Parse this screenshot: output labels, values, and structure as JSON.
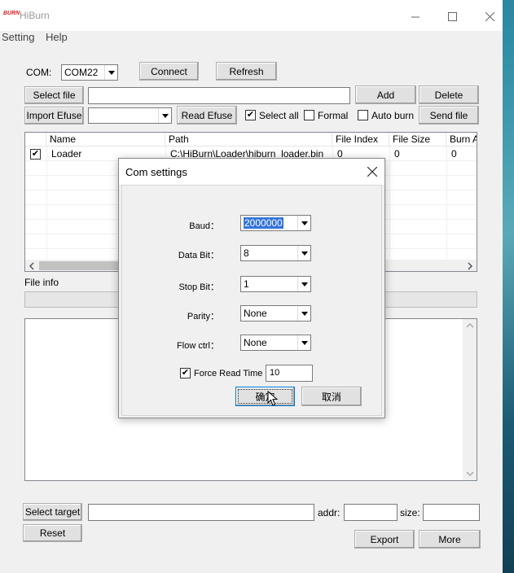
{
  "app": {
    "title": "HiBurn",
    "logo_text": "BURN",
    "window_controls": [
      "minimize-icon",
      "maximize-icon",
      "close-icon"
    ]
  },
  "menu": {
    "items": [
      "Setting",
      "Help"
    ]
  },
  "com_row": {
    "label": "COM:",
    "port_value": "COM22",
    "connect_label": "Connect",
    "refresh_label": "Refresh"
  },
  "file_row": {
    "select_file_label": "Select file",
    "file_path_value": "",
    "add_label": "Add",
    "delete_label": "Delete"
  },
  "efuse_row": {
    "import_efuse_label": "Import Efuse",
    "efuse_select_value": "",
    "read_efuse_label": "Read Efuse",
    "select_all_label": "Select all",
    "select_all_checked": true,
    "formal_label": "Formal",
    "formal_checked": false,
    "auto_burn_label": "Auto burn",
    "auto_burn_checked": false,
    "send_file_label": "Send file"
  },
  "table": {
    "columns": [
      "Name",
      "Path",
      "File Index",
      "File Size",
      "Burn A"
    ],
    "rows": [
      {
        "checked": true,
        "name": "Loader",
        "path": "C:\\HiBurn\\Loader\\hiburn_loader.bin",
        "file_index": "0",
        "file_size": "0",
        "burn_a": "0"
      }
    ]
  },
  "file_info": {
    "label": "File info"
  },
  "bottom": {
    "select_target_label": "Select target",
    "target_value": "",
    "addr_label": "addr:",
    "addr_value": "",
    "size_label": "size:",
    "size_value": "",
    "reset_label": "Reset",
    "export_label": "Export",
    "more_label": "More"
  },
  "dialog": {
    "title": "Com settings",
    "fields": [
      {
        "label": "Baud：",
        "value": "2000000"
      },
      {
        "label": "Data Bit：",
        "value": "8"
      },
      {
        "label": "Stop Bit：",
        "value": "1"
      },
      {
        "label": "Parity：",
        "value": "None"
      },
      {
        "label": "Flow ctrl：",
        "value": "None"
      }
    ],
    "force_read_label": "Force Read Time",
    "force_read_checked": true,
    "force_read_value": "10",
    "ok_label": "确定",
    "cancel_label": "取消"
  },
  "colors": {
    "accent_selection": "#3374d9",
    "logo_red": "#dd2222",
    "window_bg": "#f0f0f0"
  }
}
